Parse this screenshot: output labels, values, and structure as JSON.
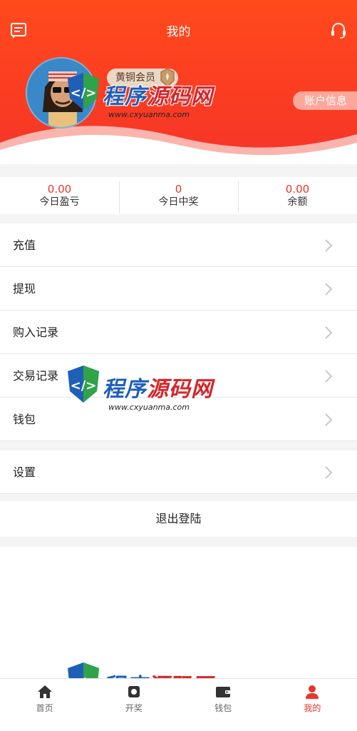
{
  "header": {
    "title": "我的",
    "message_icon": "message-icon",
    "service_icon": "headset-icon",
    "badge_label": "黄铜会员",
    "account_button": "账户信息"
  },
  "stats": [
    {
      "value": "0.00",
      "label": "今日盈亏"
    },
    {
      "value": "0",
      "label": "今日中奖"
    },
    {
      "value": "0.00",
      "label": "余额"
    }
  ],
  "menu": {
    "recharge": "充值",
    "withdraw": "提现",
    "purchase_records": "购入记录",
    "trade_records": "交易记录",
    "wallet": "钱包",
    "settings": "设置"
  },
  "logout": "退出登陆",
  "tabs": [
    {
      "label": "首页",
      "icon": "home-icon"
    },
    {
      "label": "开奖",
      "icon": "lottery-icon"
    },
    {
      "label": "钱包",
      "icon": "wallet-icon"
    },
    {
      "label": "我的",
      "icon": "user-icon"
    }
  ],
  "watermark": {
    "text_a": "程序",
    "text_b": "源码网",
    "url": "www.cxyuanma.com"
  },
  "colors": {
    "accent": "#e8352b",
    "header_gradient_top": "#ff4a1c",
    "header_gradient_bottom": "#f5352a"
  }
}
